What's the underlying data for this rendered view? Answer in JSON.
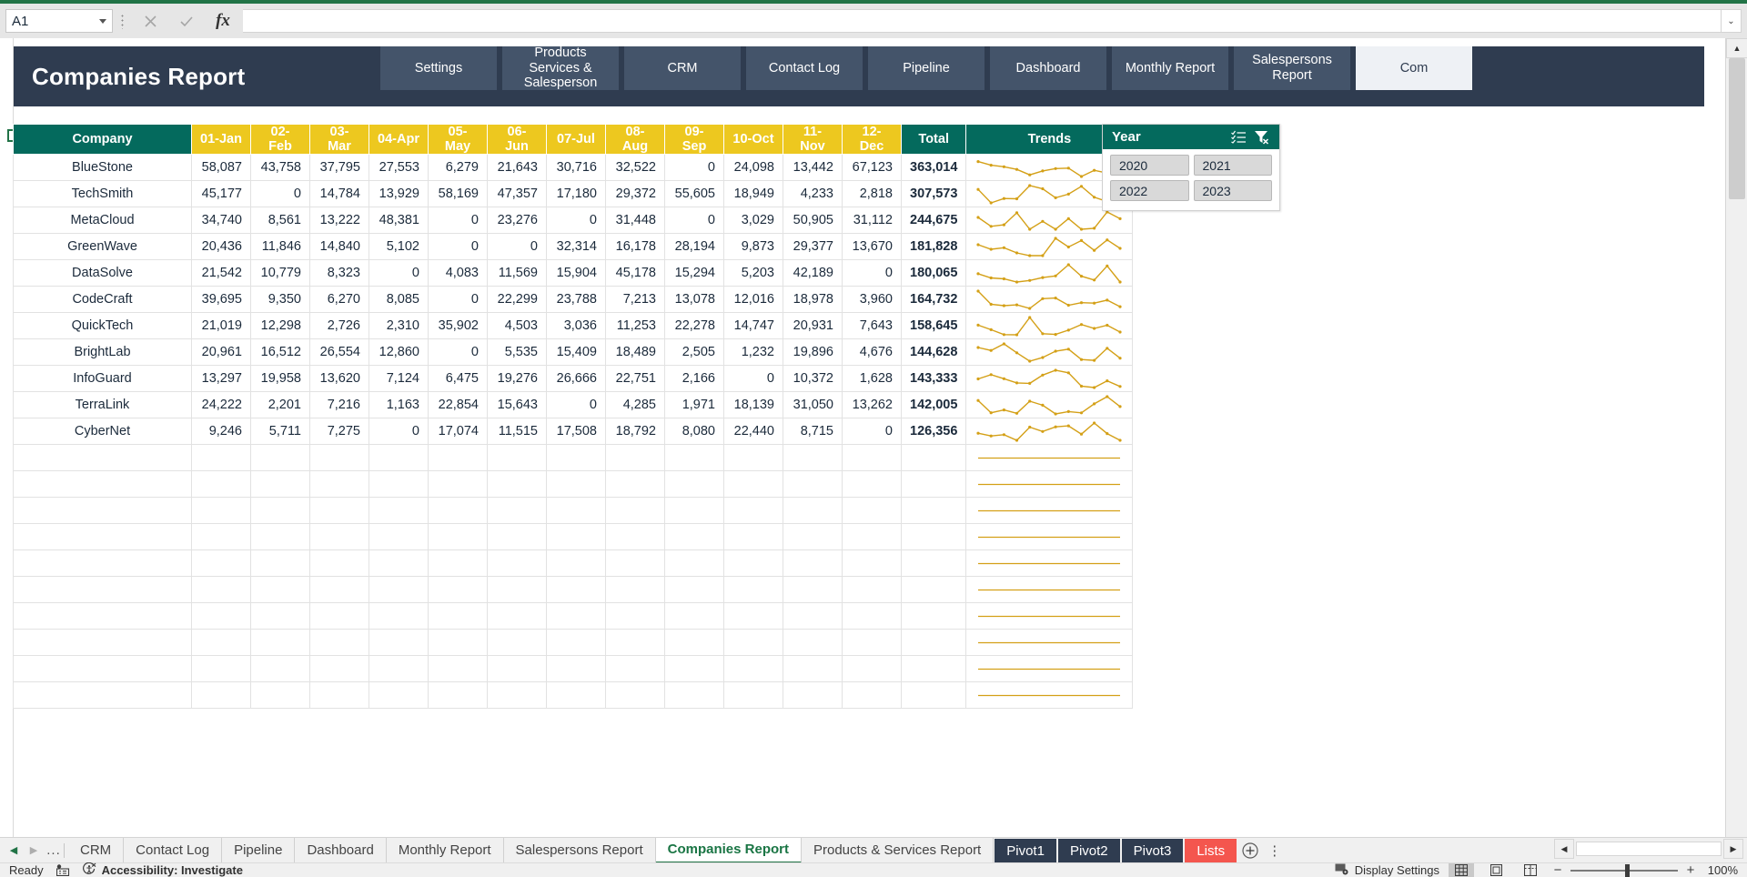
{
  "formula_bar": {
    "name_box_value": "A1",
    "cancel_icon": "close-icon",
    "confirm_icon": "check-icon",
    "fx_label": "fx",
    "formula_value": "",
    "expand_caret": "⌄"
  },
  "banner": {
    "title": "Companies Report",
    "nav_buttons": [
      {
        "label": "Settings",
        "active": false
      },
      {
        "label": "Products Services & Salesperson",
        "active": false
      },
      {
        "label": "CRM",
        "active": false
      },
      {
        "label": "Contact Log",
        "active": false
      },
      {
        "label": "Pipeline",
        "active": false
      },
      {
        "label": "Dashboard",
        "active": false
      },
      {
        "label": "Monthly Report",
        "active": false
      },
      {
        "label": "Salespersons Report",
        "active": false
      },
      {
        "label": "Com",
        "active": true
      }
    ]
  },
  "table": {
    "headers": [
      "Company",
      "01-Jan",
      "02-Feb",
      "03-Mar",
      "04-Apr",
      "05-May",
      "06-Jun",
      "07-Jul",
      "08-Aug",
      "09-Sep",
      "10-Oct",
      "11-Nov",
      "12-Dec",
      "Total",
      "Trends"
    ],
    "rows": [
      {
        "company": "BlueStone",
        "months": [
          "58,087",
          "43,758",
          "37,795",
          "27,553",
          "6,279",
          "21,643",
          "30,716",
          "32,522",
          "0",
          "24,098",
          "13,442",
          "67,123"
        ],
        "total": "363,014"
      },
      {
        "company": "TechSmith",
        "months": [
          "45,177",
          "0",
          "14,784",
          "13,929",
          "58,169",
          "47,357",
          "17,180",
          "29,372",
          "55,605",
          "18,949",
          "4,233",
          "2,818"
        ],
        "total": "307,573"
      },
      {
        "company": "MetaCloud",
        "months": [
          "34,740",
          "8,561",
          "13,222",
          "48,381",
          "0",
          "23,276",
          "0",
          "31,448",
          "0",
          "3,029",
          "50,905",
          "31,112"
        ],
        "total": "244,675"
      },
      {
        "company": "GreenWave",
        "months": [
          "20,436",
          "11,846",
          "14,840",
          "5,102",
          "0",
          "0",
          "32,314",
          "16,178",
          "28,194",
          "9,873",
          "29,377",
          "13,670"
        ],
        "total": "181,828"
      },
      {
        "company": "DataSolve",
        "months": [
          "21,542",
          "10,779",
          "8,323",
          "0",
          "4,083",
          "11,569",
          "15,904",
          "45,178",
          "15,294",
          "5,203",
          "42,189",
          "0"
        ],
        "total": "180,065"
      },
      {
        "company": "CodeCraft",
        "months": [
          "39,695",
          "9,350",
          "6,270",
          "8,085",
          "0",
          "22,299",
          "23,788",
          "7,213",
          "13,078",
          "12,016",
          "18,978",
          "3,960"
        ],
        "total": "164,732"
      },
      {
        "company": "QuickTech",
        "months": [
          "21,019",
          "12,298",
          "2,726",
          "2,310",
          "35,902",
          "4,503",
          "3,036",
          "11,253",
          "22,278",
          "14,747",
          "20,931",
          "7,643"
        ],
        "total": "158,645"
      },
      {
        "company": "BrightLab",
        "months": [
          "20,961",
          "16,512",
          "26,554",
          "12,860",
          "0",
          "5,535",
          "15,409",
          "18,489",
          "2,505",
          "1,232",
          "19,896",
          "4,676"
        ],
        "total": "144,628"
      },
      {
        "company": "InfoGuard",
        "months": [
          "13,297",
          "19,958",
          "13,620",
          "7,124",
          "6,475",
          "19,276",
          "26,666",
          "22,751",
          "2,166",
          "0",
          "10,372",
          "1,628"
        ],
        "total": "143,333"
      },
      {
        "company": "TerraLink",
        "months": [
          "24,222",
          "2,201",
          "7,216",
          "1,163",
          "22,854",
          "15,643",
          "0",
          "4,285",
          "1,971",
          "18,139",
          "31,050",
          "13,262"
        ],
        "total": "142,005"
      },
      {
        "company": "CyberNet",
        "months": [
          "9,246",
          "5,711",
          "7,275",
          "0",
          "17,074",
          "11,515",
          "17,508",
          "18,792",
          "8,080",
          "22,440",
          "8,715",
          "0"
        ],
        "total": "126,356"
      }
    ],
    "empty_rows": 10,
    "sparkline_color": "#d4a017",
    "header_company_color": "#046a5d",
    "header_month_color": "#edc81f"
  },
  "slicer": {
    "title": "Year",
    "multiselect_icon": "multi-select-icon",
    "clear_filter_icon": "clear-filter-icon",
    "items": [
      "2020",
      "2021",
      "2022",
      "2023"
    ]
  },
  "sheet_tabs": {
    "first_arrow": "◀",
    "last_arrow": "▶",
    "ellipsis": "...",
    "add_label": "+",
    "more_label": "⋮",
    "tabs": [
      {
        "label": "CRM",
        "style": "plain"
      },
      {
        "label": "Contact Log",
        "style": "plain"
      },
      {
        "label": "Pipeline",
        "style": "plain"
      },
      {
        "label": "Dashboard",
        "style": "plain"
      },
      {
        "label": "Monthly Report",
        "style": "plain"
      },
      {
        "label": "Salespersons Report",
        "style": "plain"
      },
      {
        "label": "Companies Report",
        "style": "active"
      },
      {
        "label": "Products & Services Report",
        "style": "plain"
      },
      {
        "label": "Pivot1",
        "style": "navy"
      },
      {
        "label": "Pivot2",
        "style": "navy"
      },
      {
        "label": "Pivot3",
        "style": "navy"
      },
      {
        "label": "Lists",
        "style": "red"
      }
    ]
  },
  "status_bar": {
    "mode": "Ready",
    "macro_icon": "record-macro-icon",
    "accessibility_icon": "accessibility-icon",
    "accessibility": "Accessibility: Investigate",
    "display_settings_icon": "display-settings-icon",
    "display_settings": "Display Settings",
    "view_normal_icon": "normal-view-icon",
    "view_layout_icon": "page-layout-icon",
    "view_break_icon": "page-break-preview-icon",
    "zoom_out": "−",
    "zoom_in": "+",
    "zoom_level": "100%"
  }
}
